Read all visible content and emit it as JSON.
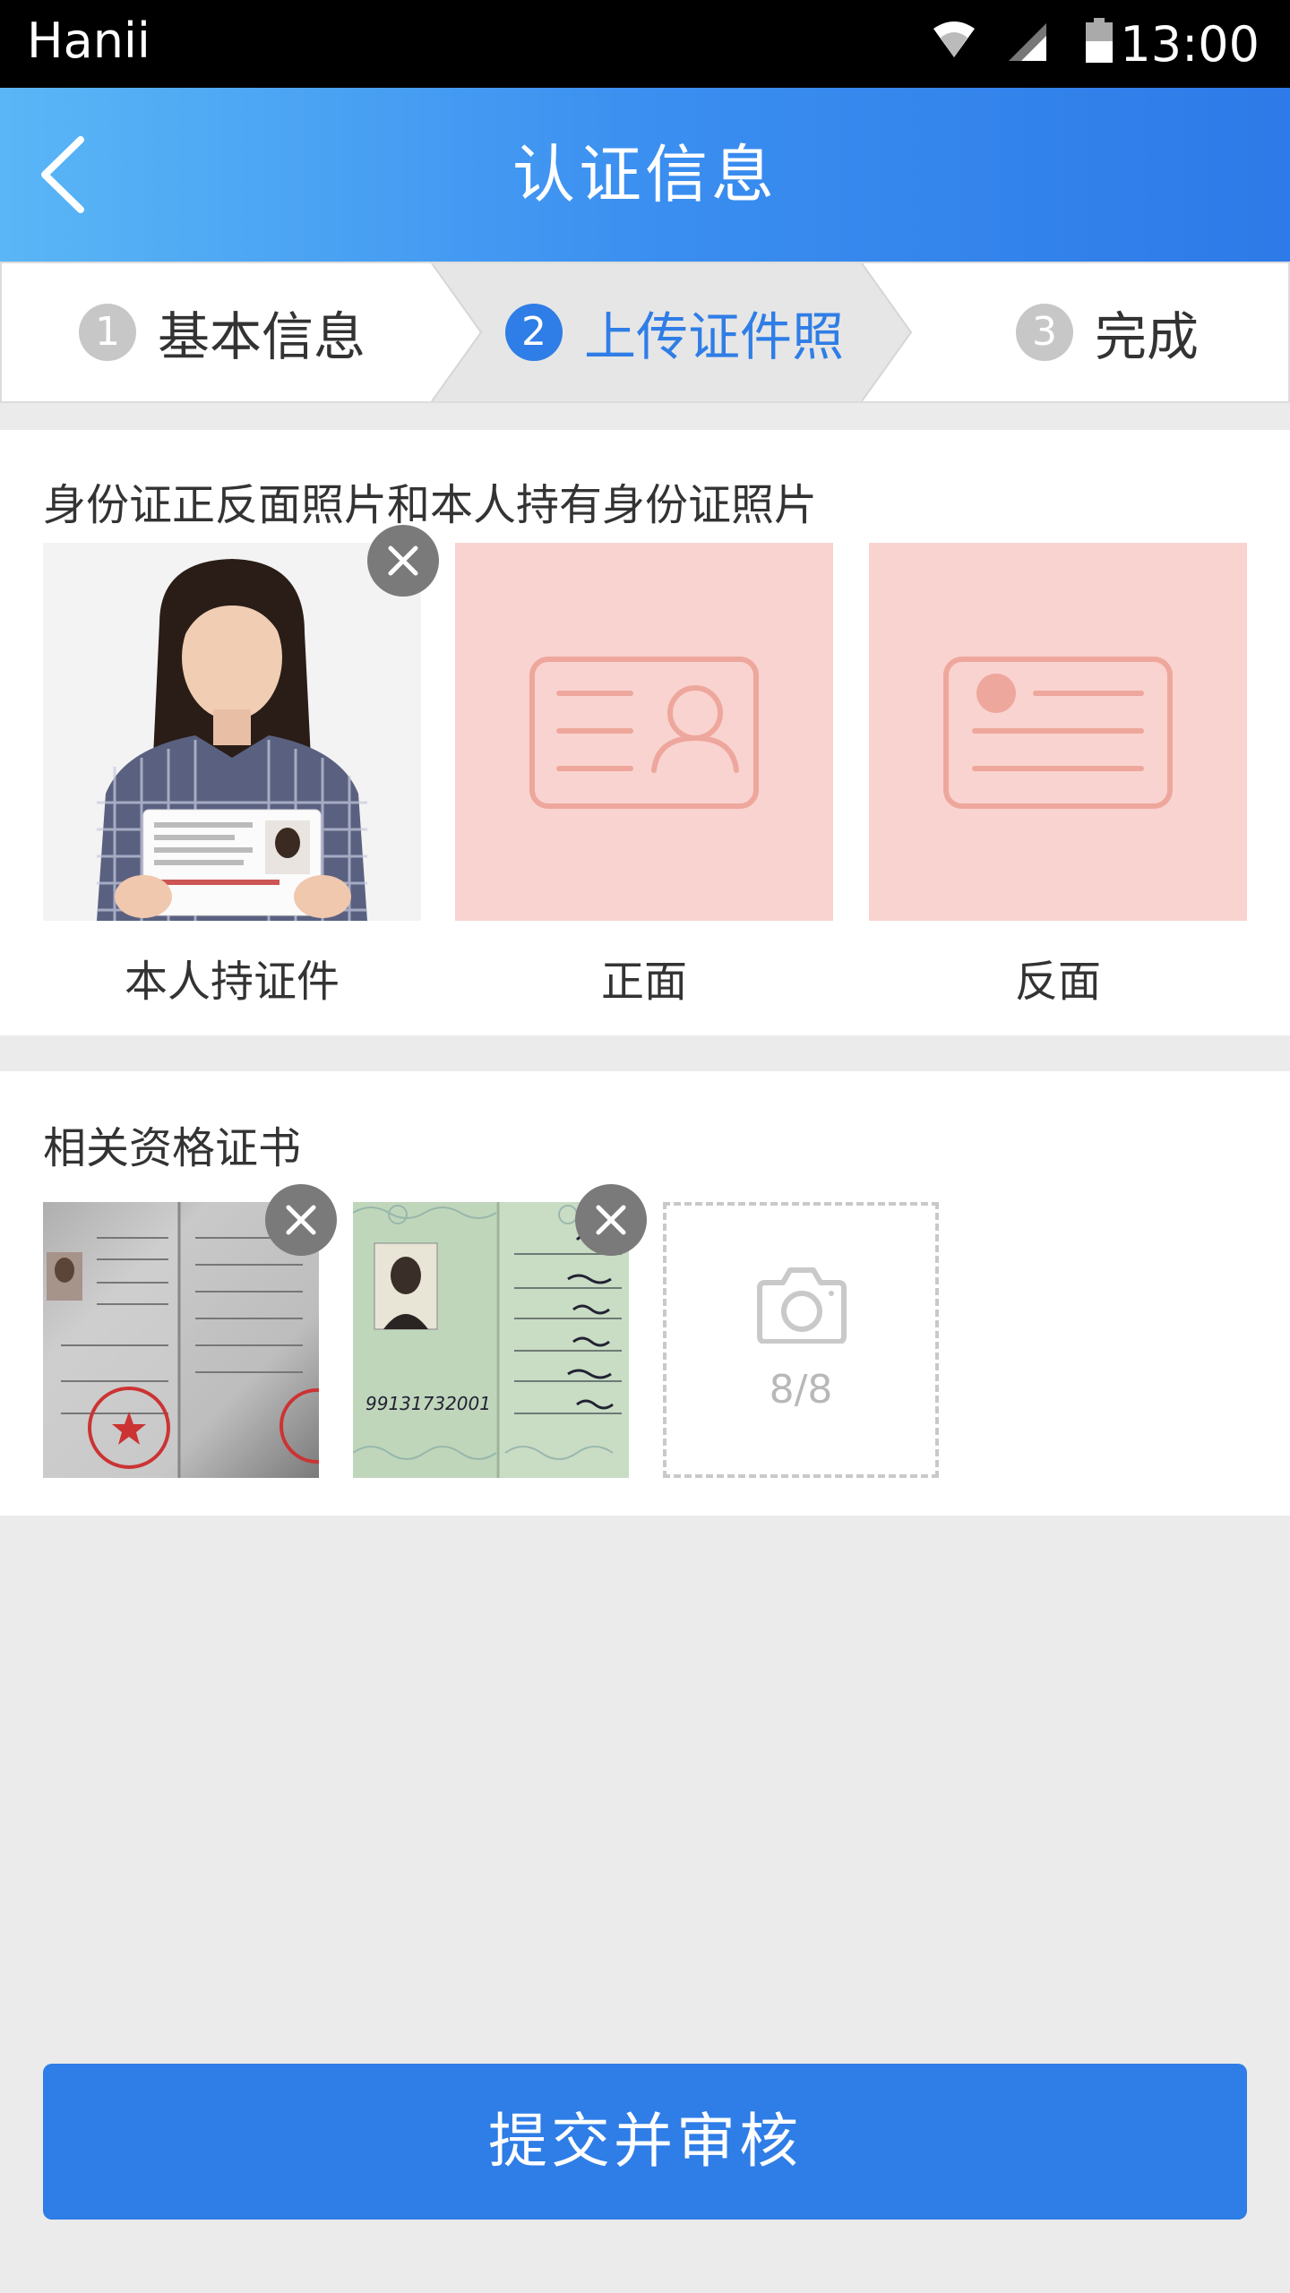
{
  "status_bar": {
    "carrier": "Hanii",
    "time": "13:00",
    "icons": [
      "wifi-icon",
      "signal-icon",
      "battery-icon"
    ]
  },
  "header": {
    "title": "认证信息",
    "back_icon": "chevron-left-icon"
  },
  "steps": [
    {
      "number": "1",
      "label": "基本信息",
      "state": "done"
    },
    {
      "number": "2",
      "label": "上传证件照",
      "state": "active"
    },
    {
      "number": "3",
      "label": "完成",
      "state": "pending"
    }
  ],
  "id_section": {
    "title": "身份证正反面照片和本人持有身份证照片",
    "items": [
      {
        "label": "本人持证件",
        "uploaded": true
      },
      {
        "label": "正面",
        "uploaded": false,
        "icon": "id-card-front-icon"
      },
      {
        "label": "反面",
        "uploaded": false,
        "icon": "id-card-back-icon"
      }
    ]
  },
  "cert_section": {
    "title": "相关资格证书",
    "add_count": "8/8",
    "add_icon": "camera-icon"
  },
  "submit_label": "提交并审核",
  "colors": {
    "primary": "#2f7de6",
    "header_gradient_start": "#5ab6f6",
    "placeholder_bg": "#f9d3d0",
    "placeholder_stroke": "#eea79c"
  }
}
